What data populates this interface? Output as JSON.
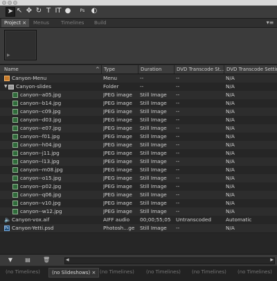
{
  "tabs": {
    "items": [
      {
        "label": "Project",
        "close": "×"
      },
      {
        "label": "Menus"
      },
      {
        "label": "Timelines"
      },
      {
        "label": "Build"
      }
    ],
    "menu_icon": "panel-menu-icon"
  },
  "columns": {
    "name": "Name",
    "sort": "^",
    "type": "Type",
    "duration": "Duration",
    "dvd_status": "DVD Transcode St...",
    "dvd_settings": "DVD Transcode Settin"
  },
  "rows": [
    {
      "name": "Canyon-Menu",
      "type": "Menu",
      "duration": "--",
      "status": "--",
      "settings": "N/A",
      "icon": "menu-sequence-icon",
      "indent": 0
    },
    {
      "name": "Canyon-slides",
      "type": "Folder",
      "duration": "--",
      "status": "--",
      "settings": "N/A",
      "icon": "folder-icon",
      "indent": 0,
      "expanded": true
    },
    {
      "name": "canyon--a05.jpg",
      "type": "JPEG image",
      "duration": "Still Image",
      "status": "--",
      "settings": "N/A",
      "icon": "image-icon",
      "indent": 1
    },
    {
      "name": "canyon--b14.jpg",
      "type": "JPEG image",
      "duration": "Still Image",
      "status": "--",
      "settings": "N/A",
      "icon": "image-icon",
      "indent": 1
    },
    {
      "name": "canyon--c09.jpg",
      "type": "JPEG image",
      "duration": "Still Image",
      "status": "--",
      "settings": "N/A",
      "icon": "image-icon",
      "indent": 1
    },
    {
      "name": "canyon--d03.jpg",
      "type": "JPEG image",
      "duration": "Still Image",
      "status": "--",
      "settings": "N/A",
      "icon": "image-icon",
      "indent": 1
    },
    {
      "name": "canyon--e07.jpg",
      "type": "JPEG image",
      "duration": "Still Image",
      "status": "--",
      "settings": "N/A",
      "icon": "image-icon",
      "indent": 1
    },
    {
      "name": "canyon--f01.jpg",
      "type": "JPEG image",
      "duration": "Still Image",
      "status": "--",
      "settings": "N/A",
      "icon": "image-icon",
      "indent": 1
    },
    {
      "name": "canyon--h04.jpg",
      "type": "JPEG image",
      "duration": "Still Image",
      "status": "--",
      "settings": "N/A",
      "icon": "image-icon",
      "indent": 1
    },
    {
      "name": "canyon--j11.jpg",
      "type": "JPEG image",
      "duration": "Still Image",
      "status": "--",
      "settings": "N/A",
      "icon": "image-icon",
      "indent": 1
    },
    {
      "name": "canyon--l13.jpg",
      "type": "JPEG image",
      "duration": "Still Image",
      "status": "--",
      "settings": "N/A",
      "icon": "image-icon",
      "indent": 1
    },
    {
      "name": "canyon--m08.jpg",
      "type": "JPEG image",
      "duration": "Still Image",
      "status": "--",
      "settings": "N/A",
      "icon": "image-icon",
      "indent": 1
    },
    {
      "name": "canyon--o15.jpg",
      "type": "JPEG image",
      "duration": "Still Image",
      "status": "--",
      "settings": "N/A",
      "icon": "image-icon",
      "indent": 1
    },
    {
      "name": "canyon--p02.jpg",
      "type": "JPEG image",
      "duration": "Still Image",
      "status": "--",
      "settings": "N/A",
      "icon": "image-icon",
      "indent": 1
    },
    {
      "name": "canyon--q06.jpg",
      "type": "JPEG image",
      "duration": "Still Image",
      "status": "--",
      "settings": "N/A",
      "icon": "image-icon",
      "indent": 1
    },
    {
      "name": "canyon--v10.jpg",
      "type": "JPEG image",
      "duration": "Still Image",
      "status": "--",
      "settings": "N/A",
      "icon": "image-icon",
      "indent": 1
    },
    {
      "name": "canyon--w12.jpg",
      "type": "JPEG image",
      "duration": "Still Image",
      "status": "--",
      "settings": "N/A",
      "icon": "image-icon",
      "indent": 1
    },
    {
      "name": "Canyon-vox.aif",
      "type": "AIFF audio",
      "duration": "00;00;55;05",
      "status": "Untranscoded",
      "settings": "Automatic",
      "icon": "audio-icon",
      "indent": 0
    },
    {
      "name": "Canyon-Yetti.psd",
      "type": "Photosh...ge",
      "duration": "Still Image",
      "status": "--",
      "settings": "N/A",
      "icon": "psd-icon",
      "indent": 0
    }
  ],
  "bottom_tabs": [
    {
      "label": "(no Timelines)"
    },
    {
      "label": "(no Slideshows)",
      "close": "×",
      "active": true
    },
    {
      "label": "(no Timelines)"
    },
    {
      "label": "(no Timelines)"
    },
    {
      "label": "(no Timelines)"
    },
    {
      "label": "(no Timelines)"
    }
  ]
}
